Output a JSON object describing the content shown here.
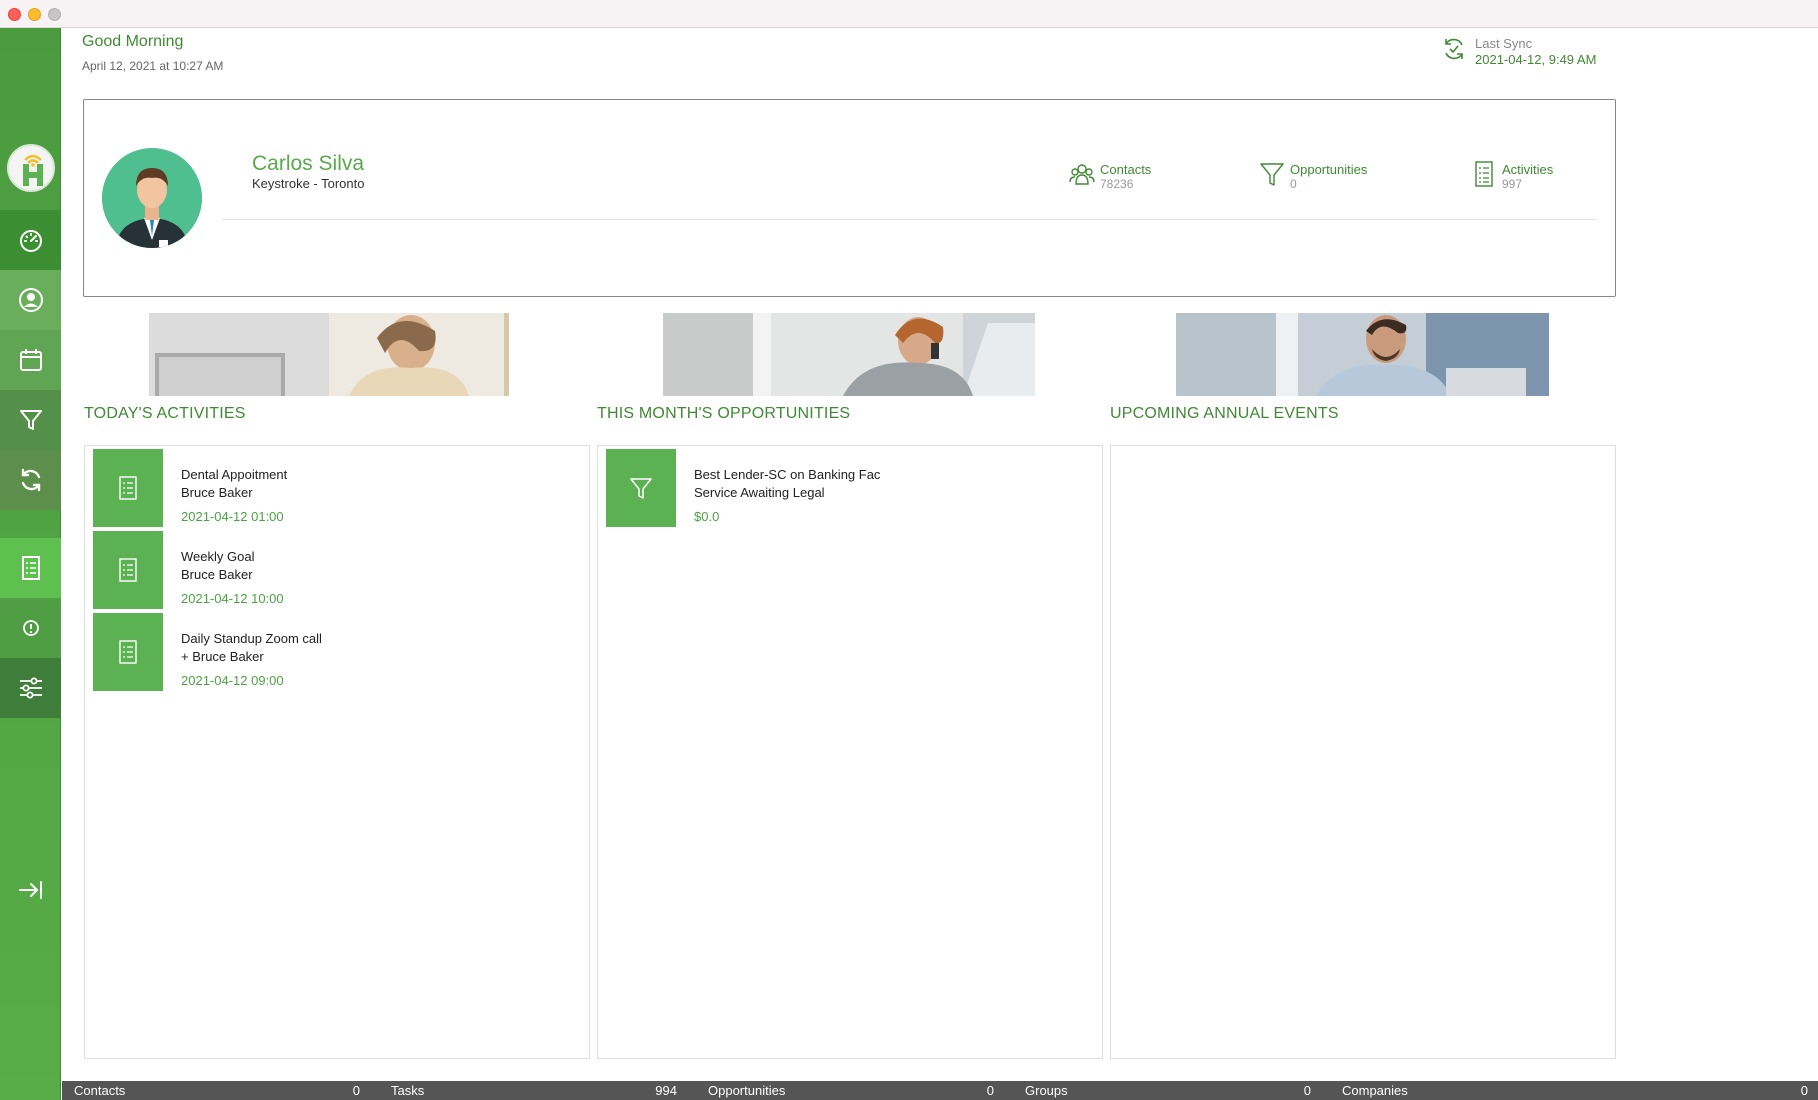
{
  "header": {
    "greeting": "Good Morning",
    "datetime": "April 12, 2021 at 10:27 AM",
    "last_sync_label": "Last Sync",
    "last_sync_value": "2021-04-12, 9:49 AM"
  },
  "sidebar": {
    "items": [
      {
        "icon": "dashboard-gauge-icon"
      },
      {
        "icon": "user-circle-icon"
      },
      {
        "icon": "calendar-icon"
      },
      {
        "icon": "funnel-icon"
      },
      {
        "icon": "sync-icon"
      },
      {
        "icon": "checklist-icon"
      },
      {
        "icon": "info-icon"
      },
      {
        "icon": "settings-sliders-icon"
      },
      {
        "icon": "collapse-arrow-icon"
      }
    ]
  },
  "profile": {
    "name": "Carlos Silva",
    "subtitle": "Keystroke - Toronto",
    "stats": [
      {
        "label": "Contacts",
        "value": "78236"
      },
      {
        "label": "Opportunities",
        "value": "0"
      },
      {
        "label": "Activities",
        "value": "997"
      }
    ]
  },
  "sections": {
    "activities_title": "TODAY'S ACTIVITIES",
    "opportunities_title": "THIS MONTH'S OPPORTUNITIES",
    "events_title": "UPCOMING ANNUAL EVENTS"
  },
  "activities": [
    {
      "title": "Dental Appoitment",
      "person": "Bruce Baker",
      "time": "2021-04-12 01:00"
    },
    {
      "title": "Weekly Goal",
      "person": "Bruce Baker",
      "time": "2021-04-12 10:00"
    },
    {
      "title": "Daily Standup Zoom call",
      "person": "+ Bruce Baker",
      "time": "2021-04-12 09:00"
    }
  ],
  "opportunities": [
    {
      "title": "Best Lender-SC on Banking Fac",
      "status": "Service Awaiting Legal",
      "amount": "$0.0"
    }
  ],
  "statusbar": [
    {
      "label": "Contacts",
      "value": "0"
    },
    {
      "label": "Tasks",
      "value": "994"
    },
    {
      "label": "Opportunities",
      "value": "0"
    },
    {
      "label": "Groups",
      "value": "0"
    },
    {
      "label": "Companies",
      "value": "0"
    }
  ],
  "colors": {
    "brand_green": "#3f8a34",
    "sidebar_green": "#52a544",
    "item_green": "#5cb152",
    "statusbar_bg": "#555555"
  }
}
